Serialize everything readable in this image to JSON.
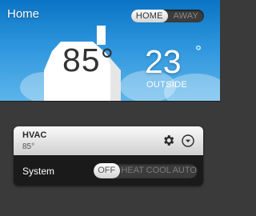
{
  "header": {
    "title": "Home",
    "mode_options": [
      {
        "label": "HOME",
        "selected": true
      },
      {
        "label": "AWAY",
        "selected": false
      }
    ]
  },
  "indoor": {
    "temperature": "85°"
  },
  "outdoor": {
    "temperature": "23",
    "unit": "°",
    "label": "OUTSIDE"
  },
  "hvac": {
    "title": "HVAC",
    "current_temp": "85°",
    "system_label": "System",
    "system_options": [
      {
        "label": "OFF",
        "selected": true
      },
      {
        "label": "HEAT",
        "selected": false
      },
      {
        "label": "COOL",
        "selected": false
      },
      {
        "label": "AUTO",
        "selected": false
      }
    ]
  },
  "icons": [
    "house-icon",
    "gear-icon",
    "chevron-down-icon"
  ],
  "colors": {
    "sky_top": "#0b74c4",
    "sky_bottom": "#5cb5ea",
    "background": "#3a3a3a",
    "card": "#1a1a1a"
  }
}
